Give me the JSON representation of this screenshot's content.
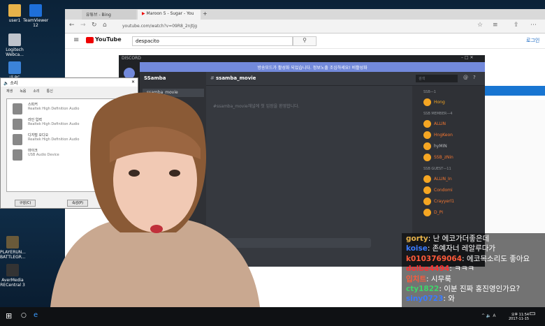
{
  "desktop": {
    "icons": [
      {
        "label": "user1",
        "color": "#e8b34a"
      },
      {
        "label": "TeamViewer 12",
        "color": "#1e6fd9"
      },
      {
        "label": "Logitech Webca...",
        "color": "#bfc4cc"
      },
      {
        "label": "내 PC",
        "color": "#3b83d8"
      },
      {
        "label": "PLAYERUN... BATTLEGR...",
        "color": "#6a5a3a"
      },
      {
        "label": "AverMedia RECentral 3",
        "color": "#333"
      }
    ]
  },
  "browser": {
    "tabs": [
      {
        "label": "유튜브 - Bing"
      },
      {
        "label": "Maroon 5 - Sugar - You"
      }
    ],
    "new_tab": "+",
    "url": "youtube.com/watch?v=09R8_2nJtjg",
    "youtube_logo": "YouTube",
    "search_value": "despacito",
    "login_label": "로그인"
  },
  "discord": {
    "title": "DISCORD",
    "notice": "방송모드가 활성화 되었습니다. 정보노출 조심하세요!  비활성화",
    "server_name": "SSamba",
    "channels": [
      {
        "label": "ssamba_movie"
      }
    ],
    "channel_title": "ssamba_movie",
    "search_placeholder": "검색",
    "welcome": "#ssamba_movie채널에 첫 입장을 환영합니다.",
    "member_groups": [
      {
        "label": "SSB—1",
        "members": [
          {
            "name": "Hong",
            "color": "#f5a623"
          }
        ]
      },
      {
        "label": "SSB MEMBER—4",
        "members": [
          {
            "name": "ALLIN",
            "color": "#f57731"
          },
          {
            "name": "HngKeon",
            "color": "#f57731"
          },
          {
            "name": "hyMIN",
            "color": "#b9bbbe"
          },
          {
            "name": "SSB_zNin",
            "color": "#f57731"
          }
        ]
      },
      {
        "label": "SSB GUEST—11",
        "members": [
          {
            "name": "ALLIN_In",
            "color": "#f57731"
          },
          {
            "name": "Condomi",
            "color": "#f57731"
          },
          {
            "name": "Crayyerl1",
            "color": "#f57731"
          },
          {
            "name": "D_PI",
            "color": "#f57731"
          }
        ]
      }
    ]
  },
  "sound_dialog": {
    "title": "소리",
    "tabs": [
      "재생",
      "녹음",
      "소리",
      "통신"
    ],
    "devices": [
      {
        "name": "스피커",
        "status": "Realtek High Definition Audio"
      },
      {
        "name": "라인 입력",
        "status": "Realtek High Definition Audio"
      },
      {
        "name": "디지털 오디오",
        "status": "Realtek High Definition Audio"
      },
      {
        "name": "마이크",
        "status": "USB Audio Device"
      }
    ],
    "configure_label": "구성(C)",
    "props_label": "속성(P)"
  },
  "chat": [
    {
      "user": "gorty",
      "text": "난 에코가더좋은데",
      "color": "#e6b24a"
    },
    {
      "user": "koise",
      "text": "존예자너 레알루다가",
      "color": "#3a7bff"
    },
    {
      "user": "k0103769064",
      "text": "에코목소리도 좋아요",
      "color": "#ff5a3a"
    },
    {
      "user": "dolbe4494",
      "text": "ㅋㅋㅋ",
      "color": "#ff3030"
    },
    {
      "user": "입치트",
      "text": "시무룩",
      "color": "#ff5a3a"
    },
    {
      "user": "cty1822",
      "text": "이분 진짜 홍진영인가요?",
      "color": "#3dd66a"
    },
    {
      "user": "siny0723",
      "text": "와",
      "color": "#3a7bff"
    }
  ],
  "taskbar": {
    "time": "오후 11:54",
    "date": "2017-11-15",
    "tray": "^ 🔈 A"
  }
}
